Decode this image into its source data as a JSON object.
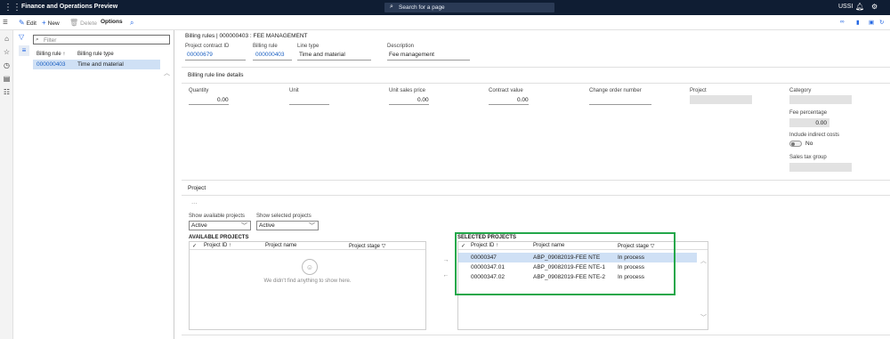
{
  "topbar": {
    "app_title": "Finance and Operations Preview",
    "search_placeholder": "Search for a page",
    "company": "USSI"
  },
  "actionpane": {
    "edit": "Edit",
    "new": "New",
    "delete": "Delete",
    "options": "Options"
  },
  "listpanel": {
    "filter_placeholder": "Filter",
    "col_rule": "Billing rule",
    "col_rule_sort": "↑",
    "col_type": "Billing rule type",
    "rows": [
      {
        "rule": "000000403",
        "type": "Time and material"
      }
    ]
  },
  "header": {
    "breadcrumb": "Billing rules | 000000403 : FEE MANAGEMENT",
    "contract_label": "Project contract ID",
    "contract_value": "00000679",
    "rule_label": "Billing rule",
    "rule_value": "000000403",
    "linetype_label": "Line type",
    "linetype_value": "Time and material",
    "desc_label": "Description",
    "desc_value": "Fee management"
  },
  "details": {
    "section_title": "Billing rule line details",
    "quantity_label": "Quantity",
    "quantity_value": "0.00",
    "unit_label": "Unit",
    "unit_value": "",
    "price_label": "Unit sales price",
    "price_value": "0.00",
    "contract_value_label": "Contract value",
    "contract_value_value": "0.00",
    "change_order_label": "Change order number",
    "project_label": "Project",
    "category_label": "Category",
    "fee_pct_label": "Fee percentage",
    "fee_pct_value": "0.00",
    "indirect_label": "Include indirect costs",
    "indirect_value": "No",
    "sales_tax_label": "Sales tax group"
  },
  "project": {
    "section_title": "Project",
    "more": "···",
    "show_available_label": "Show available projects",
    "show_available_value": "Active",
    "show_selected_label": "Show selected projects",
    "show_selected_value": "Active",
    "available_title": "AVAILABLE PROJECTS",
    "available_cols": [
      "Project ID ↑",
      "Project name",
      "Project stage"
    ],
    "empty_msg": "We didn't find anything to show here.",
    "selected_title": "SELECTED PROJECTS",
    "selected_cols": [
      "Project ID ↑",
      "Project name",
      "Project stage"
    ],
    "selected_rows": [
      {
        "id": "00000347",
        "name": "ABP_09082019-FEE NTE",
        "stage": "In process"
      },
      {
        "id": "00000347.01",
        "name": "ABP_09082019-FEE NTE-1",
        "stage": "In process"
      },
      {
        "id": "00000347.02",
        "name": "ABP_09082019-FEE NTE-2",
        "stage": "In process"
      }
    ]
  },
  "colors": {
    "topbar": "#0f1d33",
    "accent": "#2266e3",
    "highlight_box": "#23a74a",
    "selected_row": "#cfe0f5"
  }
}
